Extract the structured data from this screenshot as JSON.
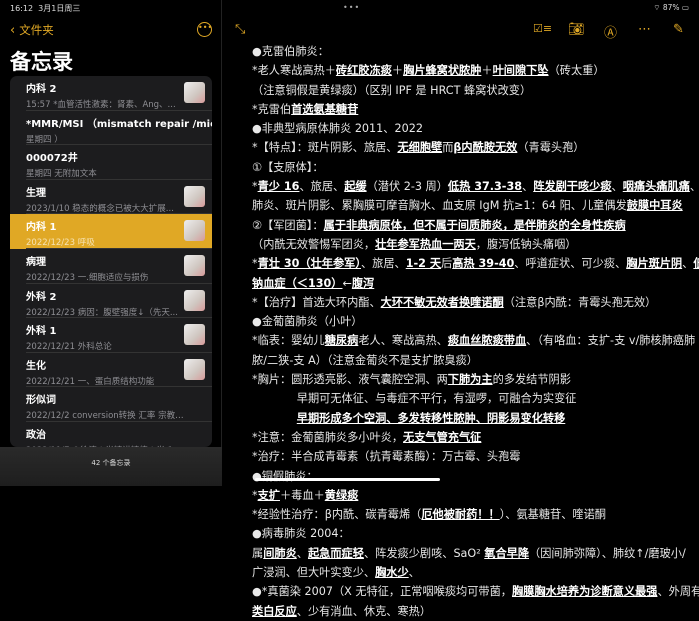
{
  "status": {
    "time": "16:12",
    "date": "3月1日周三",
    "battery": "87%"
  },
  "sidebar": {
    "back_label": "文件夹",
    "title": "备忘录",
    "count": "42 个备忘录",
    "notes": [
      {
        "name": "内科 2",
        "sub": "15:57  *血管活性激素：肾素、Ang、...",
        "thumb": true
      },
      {
        "name": "*MMR/MSI （mismatch repair /micros...",
        "sub": "星期四 ）",
        "thumb": false
      },
      {
        "name": "000072井",
        "sub": "星期四  无附加文本",
        "thumb": false
      },
      {
        "name": "生理",
        "sub": "2023/1/10  稳态的概念已被大大扩展...",
        "thumb": true
      },
      {
        "name": "内科 1",
        "sub": "2022/12/23  呼吸",
        "thumb": true,
        "selected": true
      },
      {
        "name": "病理",
        "sub": "2022/12/23  一.细胞适应与损伤",
        "thumb": true
      },
      {
        "name": "外科 2",
        "sub": "2022/12/23  病因：腹壁强度↓（先天...",
        "thumb": true
      },
      {
        "name": "外科 1",
        "sub": "2022/12/21  外科总论",
        "thumb": true
      },
      {
        "name": "生化",
        "sub": "2022/12/21  一、蛋白质结构功能",
        "thumb": true
      },
      {
        "name": "形似词",
        "sub": "2022/12/2  conversion转换 汇率 宗教 信仰转变",
        "thumb": false
      },
      {
        "name": "政治",
        "sub": "2022/11/7  ①徐涛＋肖精讲精练＋肖 1000（手...",
        "thumb": false
      }
    ]
  },
  "colors": {
    "accent": "#e0a825",
    "selected_row": "#e0a825"
  },
  "toolbar": {
    "icons": [
      "expand-icon",
      "checklist-icon",
      "camera-icon",
      "markup-icon",
      "more-icon",
      "compose-icon"
    ]
  },
  "note": {
    "lines": [
      [
        {
          "t": "●克雷伯肺炎："
        }
      ],
      [
        {
          "t": "*老人寒战高热＋"
        },
        {
          "t": "砖红胶冻痰",
          "u": 1
        },
        {
          "t": "＋"
        },
        {
          "t": "胸片蜂窝状脓肿",
          "u": 1
        },
        {
          "t": "＋"
        },
        {
          "t": "叶间隙下坠",
          "u": 1
        },
        {
          "t": "（砖太重）"
        }
      ],
      [
        {
          "t": "（注意铜假是黄绿痰）（区别 IPF 是 HRCT 蜂窝状改变）"
        }
      ],
      [
        {
          "t": "*克雷伯"
        },
        {
          "t": "首选氨基糖苷",
          "u": 1
        }
      ],
      [
        {
          "t": "●非典型病原体肺炎 2011、2022"
        }
      ],
      [
        {
          "t": "*【特点】：斑片阴影、旅居、"
        },
        {
          "t": "无细胞壁",
          "u": 1
        },
        {
          "t": "而"
        },
        {
          "t": "β内酰胺无效",
          "u": 1
        },
        {
          "t": "（青霉头孢）"
        }
      ],
      [
        {
          "t": "①【支原体】："
        }
      ],
      [
        {
          "t": "*"
        },
        {
          "t": "青少 16",
          "u": 1
        },
        {
          "t": "、旅居、"
        },
        {
          "t": "起缓",
          "u": 1
        },
        {
          "t": "（潜伏 2-3 周）"
        },
        {
          "t": "低热 37.3-38",
          "u": 1
        },
        {
          "t": "、"
        },
        {
          "t": "阵发剧干咳少痰",
          "u": 1
        },
        {
          "t": "、"
        },
        {
          "t": "咽痛头痛肌痛",
          "u": 1
        },
        {
          "t": "、间"
        }
      ],
      [
        {
          "t": "肺炎、斑片阴影、累胸膜可摩音胸水、血支原 IgM 抗≥1：64 阳、儿童偶发"
        },
        {
          "t": "鼓膜中耳炎",
          "u": 1
        }
      ],
      [
        {
          "t": "②【军团菌】："
        },
        {
          "t": "属于非典病原体，但不属于间质肺炎，是伴肺炎的全身性疾病",
          "u": 1
        }
      ],
      [
        {
          "t": "（内酰无效警惕军团炎，"
        },
        {
          "t": "壮年参军热血一两天",
          "u": 1
        },
        {
          "t": "，腹泻低钠头痛咽）"
        }
      ],
      [
        {
          "t": "*"
        },
        {
          "t": "青壮 30（壮年参军）",
          "u": 1
        },
        {
          "t": "、旅居、"
        },
        {
          "t": "1-2 天",
          "u": 1
        },
        {
          "t": "后"
        },
        {
          "t": "高热 39-40",
          "u": 1
        },
        {
          "t": "、呼道症状、可少痰、"
        },
        {
          "t": "胸片斑片阴",
          "u": 1
        },
        {
          "t": "、"
        },
        {
          "t": "低",
          "u": 1
        }
      ],
      [
        {
          "t": "钠血症（＜130）",
          "u": 1
        },
        {
          "t": "←"
        },
        {
          "t": "腹泻",
          "u": 1
        }
      ],
      [
        {
          "t": "*【治疗】首选大环内酯、"
        },
        {
          "t": "大环不敏无效者换喹诺酮",
          "u": 1
        },
        {
          "t": "（注意β内酰：青霉头孢无效）"
        }
      ],
      [
        {
          "t": "●金葡菌肺炎（小叶）"
        }
      ],
      [
        {
          "t": "*临表：婴幼儿"
        },
        {
          "t": "糖尿病",
          "u": 1
        },
        {
          "t": "老人、寒战高热、"
        },
        {
          "t": "痰血丝脓痰带血",
          "u": 1
        },
        {
          "t": "、（有咯血：支扩-支 v/肺核肺癌肺"
        }
      ],
      [
        {
          "t": "脓/二狭-支 A）（注意金葡炎不是支扩脓臭痰）"
        }
      ],
      [
        {
          "t": "*胸片：圆形透亮影、液气囊腔空洞、两"
        },
        {
          "t": "下肺为主",
          "u": 1
        },
        {
          "t": "的多发结节阴影"
        }
      ],
      [
        {
          "t": "　　　　早期可无体征、与毒症不平行，有湿啰，可融合为实变征"
        }
      ],
      [
        {
          "t": "　　　　"
        },
        {
          "t": "早期形成多个空洞、多发转移性脓肿、阴影易变化转移",
          "u": 1
        }
      ],
      [
        {
          "t": "*注意：金葡菌肺炎多小叶炎，"
        },
        {
          "t": "无支气管充气征",
          "u": 1
        }
      ],
      [
        {
          "t": "*治疗：半合成青霉素（抗青霉素酶）：万古霉、头孢霉"
        }
      ],
      [
        {
          "t": "●铜假肺炎："
        }
      ],
      [
        {
          "t": "*"
        },
        {
          "t": "支扩",
          "u": 1
        },
        {
          "t": "＋毒血＋"
        },
        {
          "t": "黄绿痰",
          "u": 1
        }
      ],
      [
        {
          "t": "*经验性治疗：β内酰、碳青霉烯（"
        },
        {
          "t": "厄他被耐药！！",
          "u": 1
        },
        {
          "t": "）、氨基糖苷、喹诺酮"
        }
      ],
      [
        {
          "t": "●病毒肺炎 2004："
        }
      ],
      [
        {
          "t": "属"
        },
        {
          "t": "间肺炎",
          "u": 1
        },
        {
          "t": "、"
        },
        {
          "t": "起急而症轻",
          "u": 1
        },
        {
          "t": "、阵发痰少剧咳、SaO² "
        },
        {
          "t": "氧合早降",
          "u": 1
        },
        {
          "t": "（因间肺弥障）、肺纹↑/磨玻小/"
        }
      ],
      [
        {
          "t": "广浸润、但大叶实变少、"
        },
        {
          "t": "胸水少",
          "u": 1
        },
        {
          "t": "、"
        }
      ],
      [
        {
          "t": "●*真菌染 2007（X 无特征，正常咽喉痰均可带菌，"
        },
        {
          "t": "胸膜胸水培养为诊断意义最强",
          "u": 1
        },
        {
          "t": "、外周有"
        }
      ],
      [
        {
          "t": "类白反应",
          "u": 1
        },
        {
          "t": "、少有消血、休克、寒热）"
        }
      ]
    ]
  }
}
